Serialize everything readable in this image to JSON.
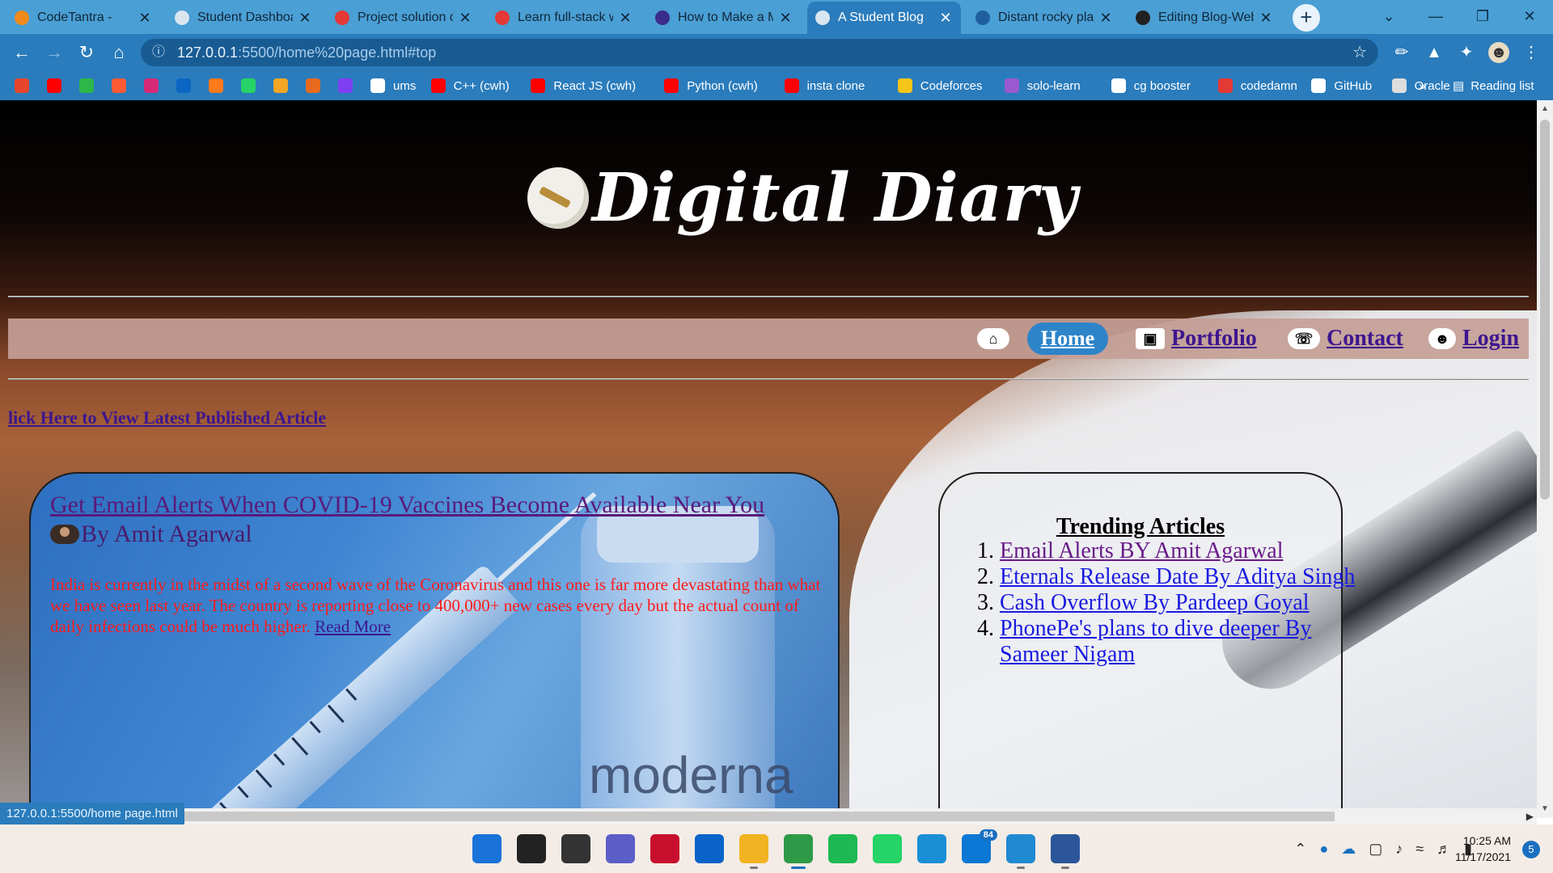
{
  "browser": {
    "tabs": [
      {
        "title": "CodeTantra -",
        "color": "#f08a1c",
        "active": false
      },
      {
        "title": "Student Dashboar",
        "color": "#d9e6f0",
        "active": false
      },
      {
        "title": "Project solution c",
        "color": "#e53935",
        "active": false
      },
      {
        "title": "Learn full-stack w",
        "color": "#e53935",
        "active": false
      },
      {
        "title": "How to Make a M",
        "color": "#3b2b8a",
        "active": false
      },
      {
        "title": "A Student Blog",
        "color": "#d9e6f0",
        "active": true
      },
      {
        "title": "Distant rocky plar",
        "color": "#1f5f9f",
        "active": false
      },
      {
        "title": "Editing Blog-Web",
        "color": "#222222",
        "active": false
      }
    ],
    "new_tab_label": "+",
    "url_host": "127.0.0.1",
    "url_rest": ":5500/home%20page.html#top",
    "bookmarks": [
      {
        "label": "",
        "color": "#e8452c"
      },
      {
        "label": "",
        "color": "#ff0000"
      },
      {
        "label": "",
        "color": "#2eb84a"
      },
      {
        "label": "",
        "color": "#ff5a36"
      },
      {
        "label": "",
        "color": "#d62976"
      },
      {
        "label": "",
        "color": "#0a66c2"
      },
      {
        "label": "",
        "color": "#ff7a1a"
      },
      {
        "label": "",
        "color": "#25d366"
      },
      {
        "label": "",
        "color": "#f5a623"
      },
      {
        "label": "",
        "color": "#e86a1e"
      },
      {
        "label": "",
        "color": "#7e3ff2"
      },
      {
        "label": "ums",
        "color": "#ffffff"
      },
      {
        "label": "C++ (cwh)",
        "color": "#ff0000"
      },
      {
        "label": "React JS (cwh)",
        "color": "#ff0000"
      },
      {
        "label": "Python (cwh)",
        "color": "#ff0000"
      },
      {
        "label": "insta clone",
        "color": "#ff0000"
      },
      {
        "label": "Codeforces",
        "color": "#f5c518"
      },
      {
        "label": "solo-learn",
        "color": "#9b59d0"
      },
      {
        "label": "cg booster",
        "color": "#ffffff"
      },
      {
        "label": "codedamn",
        "color": "#e53935"
      },
      {
        "label": "GitHub",
        "color": "#ffffff"
      },
      {
        "label": "Oracle",
        "color": "#dddddd"
      }
    ],
    "overflow_label": "»",
    "reading_list_label": "Reading list",
    "status_url": "127.0.0.1:5500/home page.html"
  },
  "site": {
    "title": "Digital Diary",
    "nav": {
      "home": "Home",
      "portfolio": "Portfolio",
      "contact": "Contact",
      "login": "Login"
    },
    "latest_link": "lick Here to View Latest Published Article",
    "article": {
      "title": "Get Email Alerts When COVID-19 Vaccines Become Available Near You",
      "author": "By Amit Agarwal",
      "body": "India is currently in the midst of a second wave of the Coronavirus and this one is far more devastating than what we have seen last year. The country is reporting close to 400,000+ new cases every day but the actual count of daily infections could be much higher.",
      "read_more": "Read More",
      "image_text": "moderna"
    },
    "trending": {
      "title": "Trending Articles",
      "items": [
        "Email Alerts BY Amit Agarwal",
        "Eternals Release Date By Aditya Singh",
        "Cash Overflow By Pardeep Goyal",
        "PhonePe's plans to dive deeper By Sameer Nigam"
      ]
    }
  },
  "taskbar": {
    "apps": [
      {
        "name": "windows-start",
        "color": "#1a73d9"
      },
      {
        "name": "search",
        "color": "#222222"
      },
      {
        "name": "task-view",
        "color": "#333333"
      },
      {
        "name": "teams-chat",
        "color": "#5b5fc7"
      },
      {
        "name": "mcafee",
        "color": "#c8102e"
      },
      {
        "name": "mail",
        "color": "#0a64c8"
      },
      {
        "name": "file-explorer",
        "color": "#f2b322"
      },
      {
        "name": "chrome",
        "color": "#2e9a47"
      },
      {
        "name": "spotify",
        "color": "#1db954"
      },
      {
        "name": "whatsapp",
        "color": "#25d366"
      },
      {
        "name": "edge",
        "color": "#1a8fd6"
      },
      {
        "name": "microsoft-store",
        "color": "#0a78d4"
      },
      {
        "name": "vscode",
        "color": "#1f8ad2"
      },
      {
        "name": "word",
        "color": "#2b579a"
      }
    ],
    "store_badge": "84",
    "time": "10:25 AM",
    "date": "11/17/2021",
    "notification_count": "5"
  }
}
